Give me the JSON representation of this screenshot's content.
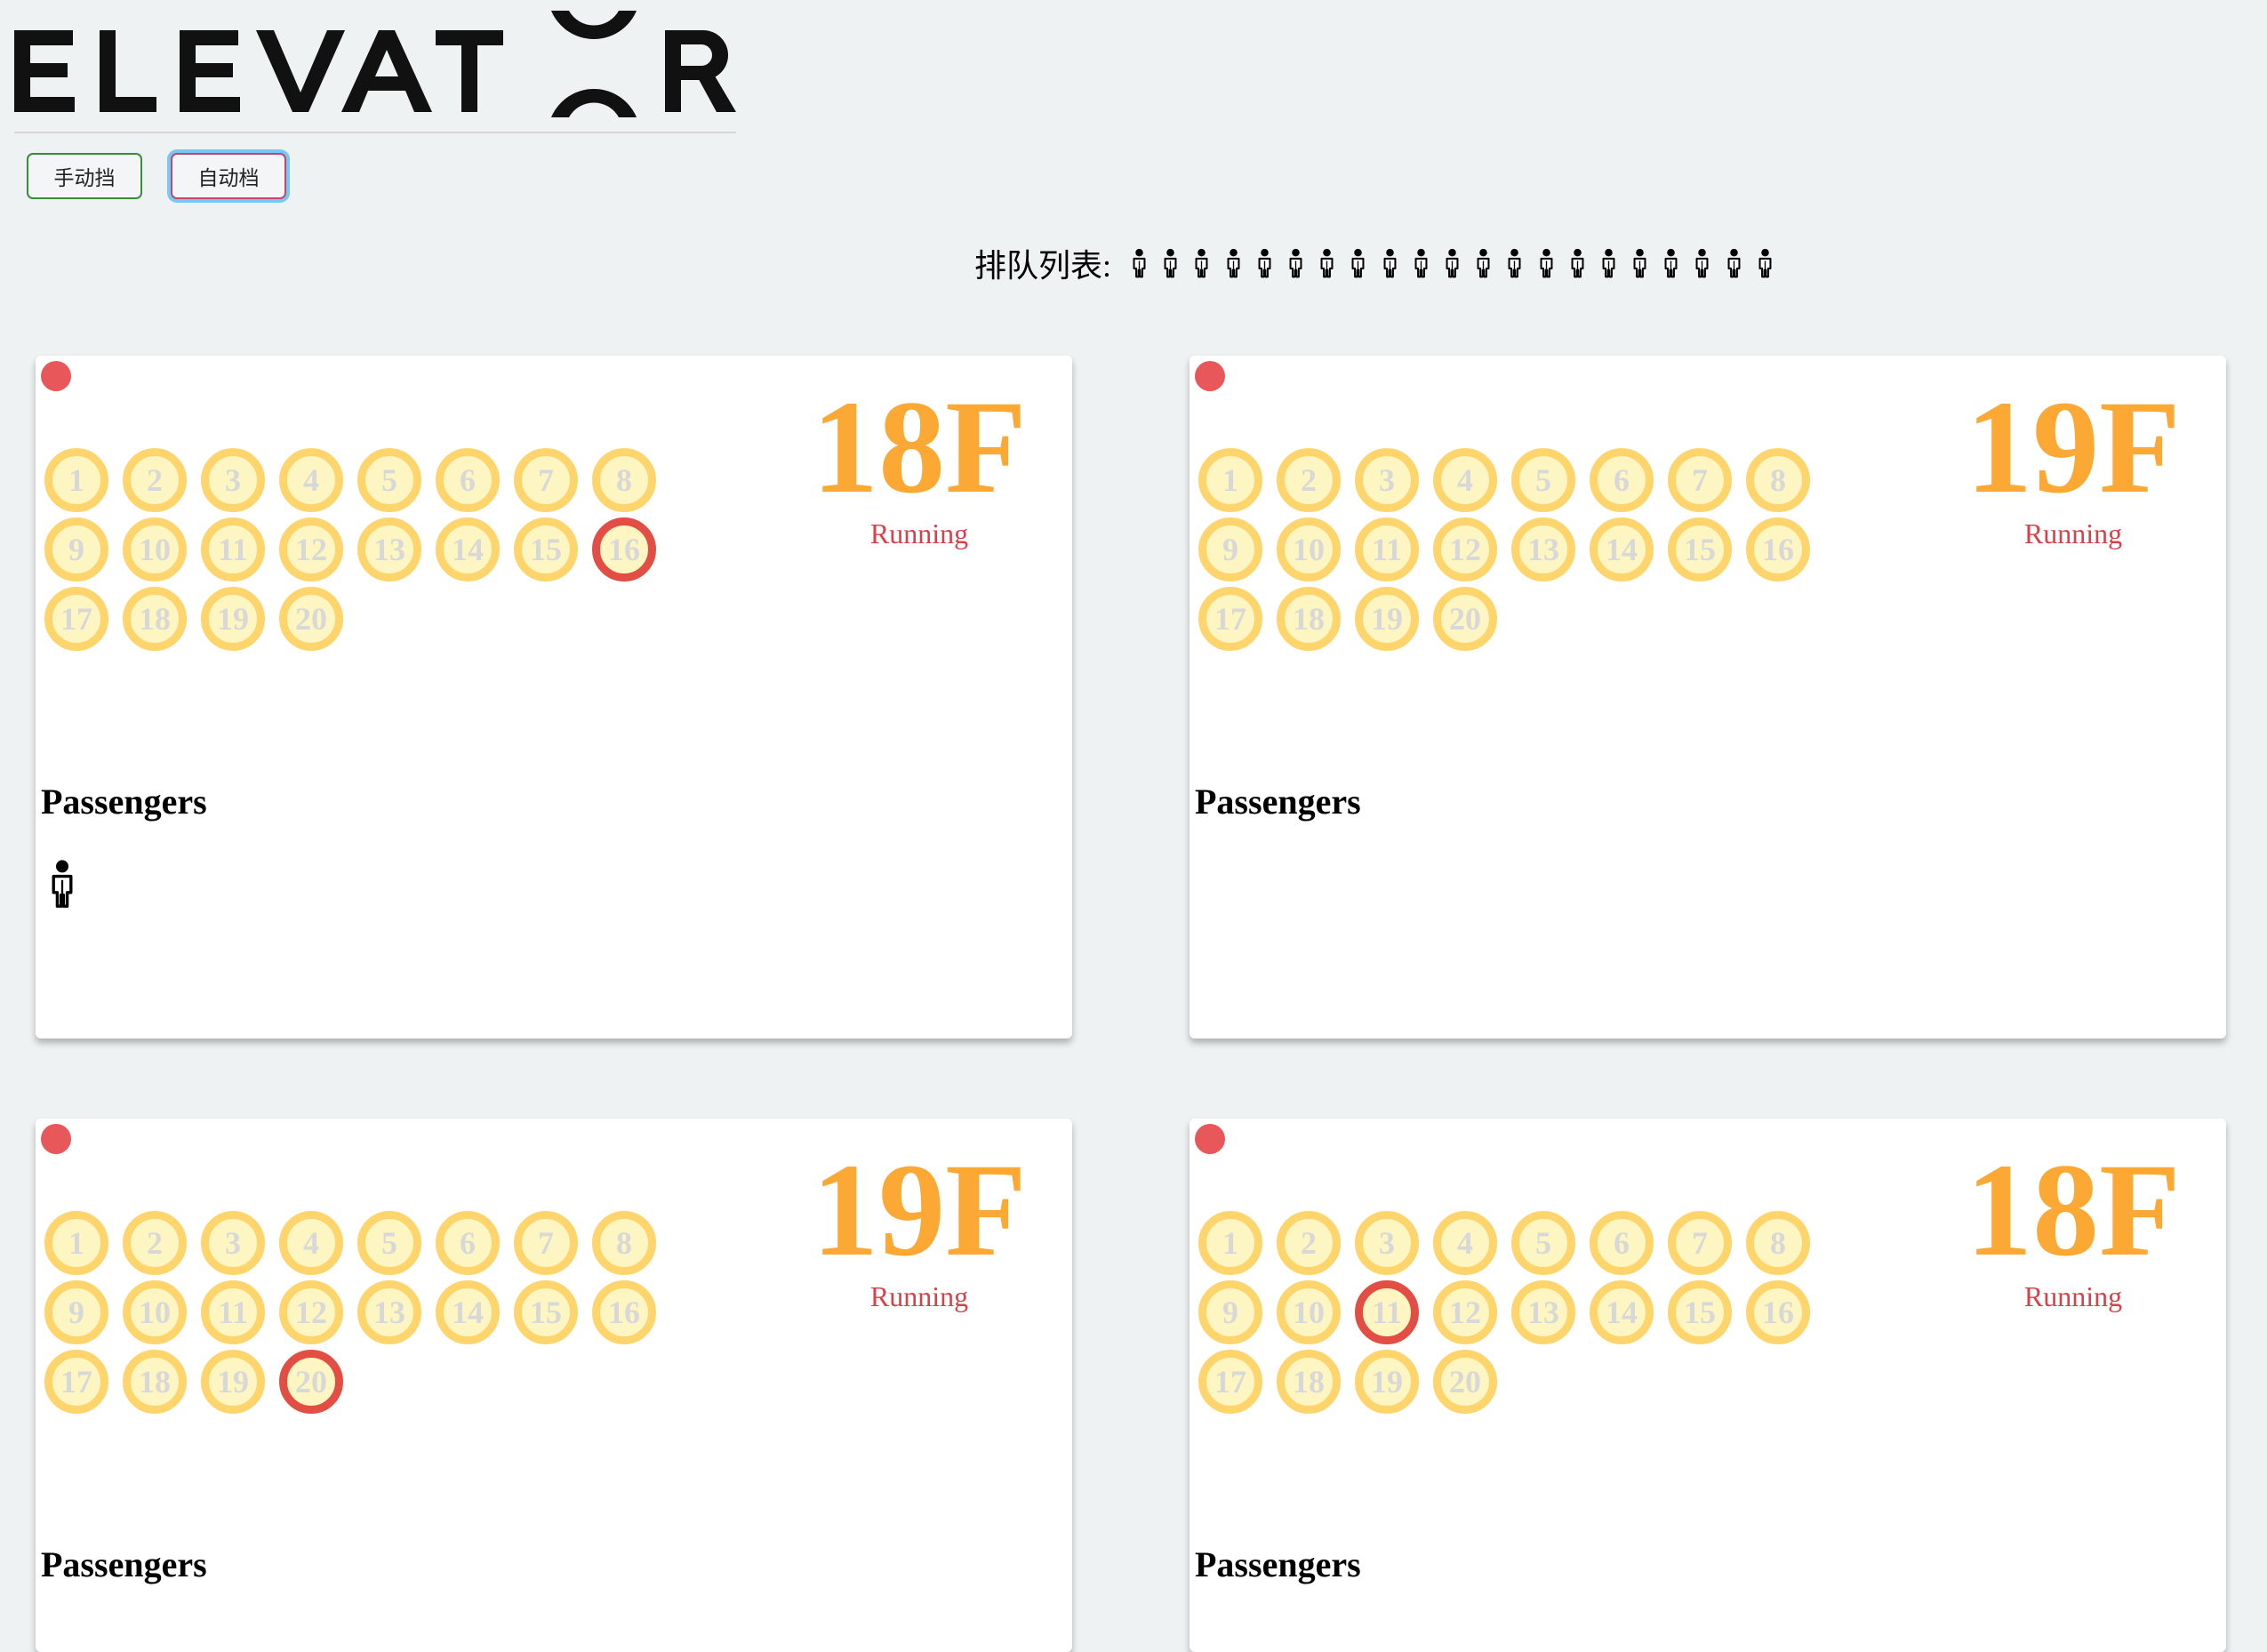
{
  "logo": {
    "text": "ELEVATOR"
  },
  "mode_buttons": {
    "manual": "手动挡",
    "auto": "自动档"
  },
  "queue": {
    "label": "排队列表:",
    "waiting_count": 21,
    "person_icon": "person-icon"
  },
  "floors": [
    "1",
    "2",
    "3",
    "4",
    "5",
    "6",
    "7",
    "8",
    "9",
    "10",
    "11",
    "12",
    "13",
    "14",
    "15",
    "16",
    "17",
    "18",
    "19",
    "20"
  ],
  "elevators": [
    {
      "current_floor": "18F",
      "status": "Running",
      "pressed_floor": 16,
      "passengers_title": "Passengers",
      "passenger_count": 1
    },
    {
      "current_floor": "19F",
      "status": "Running",
      "pressed_floor": null,
      "passengers_title": "Passengers",
      "passenger_count": 0
    },
    {
      "current_floor": "19F",
      "status": "Running",
      "pressed_floor": 20,
      "passengers_title": "Passengers",
      "passenger_count": 0
    },
    {
      "current_floor": "18F",
      "status": "Running",
      "pressed_floor": 11,
      "passengers_title": "Passengers",
      "passenger_count": 0
    }
  ],
  "colors": {
    "background": "#eff2f3",
    "floor_button_fill": "#fdf5c2",
    "floor_button_ring": "#fdd56c",
    "floor_button_pressed_ring": "#e34e44",
    "floor_display": "#fba934",
    "status_text": "#d9414a",
    "status_dot": "#e85759"
  }
}
